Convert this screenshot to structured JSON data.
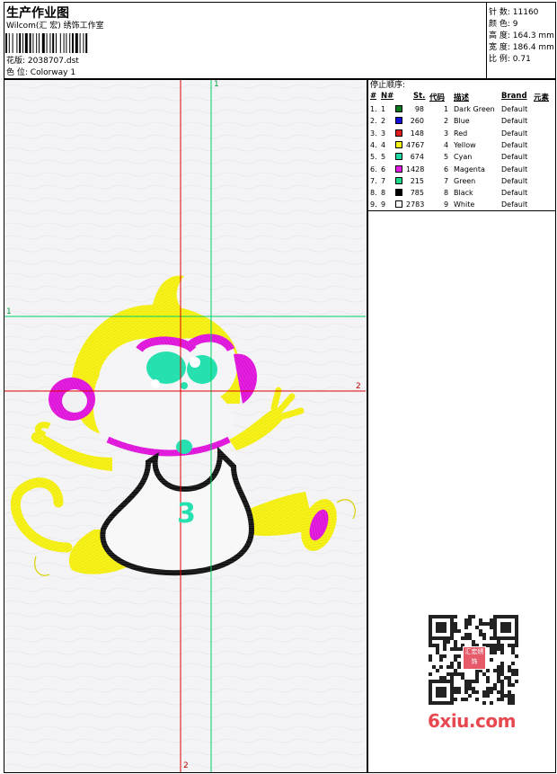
{
  "header": {
    "title": "生产作业图",
    "company": "Wilcom(汇 宏) 绣饰工作室",
    "design_label": "花版:",
    "design_file": "2038707.dst",
    "colorway_label": "色 位:",
    "colorway": "Colorway 1"
  },
  "stats": {
    "stitches_label": "针 数:",
    "stitches": "11160",
    "colors_label": "颜 色:",
    "colors": "9",
    "height_label": "高 度:",
    "height": "164.3 mm",
    "width_label": "宽 度:",
    "width": "186.4 mm",
    "ratio_label": "比 例:",
    "ratio": "0.71"
  },
  "stop_sequence": {
    "title": "停止顺序:",
    "columns": [
      "#",
      "N#",
      "St.",
      "代码",
      "描述",
      "Brand",
      "元素"
    ],
    "rows": [
      {
        "idx": "1.",
        "n": "1",
        "color": "#0b7a1d",
        "st": "98",
        "code": "1",
        "desc": "Dark Green",
        "brand": "Default"
      },
      {
        "idx": "2.",
        "n": "2",
        "color": "#1010d8",
        "st": "260",
        "code": "2",
        "desc": "Blue",
        "brand": "Default"
      },
      {
        "idx": "3.",
        "n": "3",
        "color": "#e11c1c",
        "st": "148",
        "code": "3",
        "desc": "Red",
        "brand": "Default"
      },
      {
        "idx": "4.",
        "n": "4",
        "color": "#f5f51c",
        "st": "4767",
        "code": "4",
        "desc": "Yellow",
        "brand": "Default"
      },
      {
        "idx": "5.",
        "n": "5",
        "color": "#20d8a8",
        "st": "674",
        "code": "5",
        "desc": "Cyan",
        "brand": "Default"
      },
      {
        "idx": "6.",
        "n": "6",
        "color": "#e01ce0",
        "st": "1428",
        "code": "6",
        "desc": "Magenta",
        "brand": "Default"
      },
      {
        "idx": "7.",
        "n": "7",
        "color": "#1cdc8c",
        "st": "215",
        "code": "7",
        "desc": "Green",
        "brand": "Default"
      },
      {
        "idx": "8.",
        "n": "8",
        "color": "#000000",
        "st": "785",
        "code": "8",
        "desc": "Black",
        "brand": "Default"
      },
      {
        "idx": "9.",
        "n": "9",
        "color": "#ffffff",
        "st": "2783",
        "code": "9",
        "desc": "White",
        "brand": "Default"
      }
    ]
  },
  "canvas": {
    "guide_top": "1",
    "guide_left": "1",
    "guide_right": "2",
    "guide_bottom": "2",
    "shirt_number": "3"
  },
  "watermark": {
    "brand": "6xiu.com",
    "seal": "汇宏绣饰"
  },
  "colors": {
    "red_guide": "#e00000",
    "green_guide": "#00d060",
    "yellow": "#f7f21a",
    "magenta": "#e51ee0",
    "cyan": "#26e0b0",
    "black": "#111111"
  }
}
